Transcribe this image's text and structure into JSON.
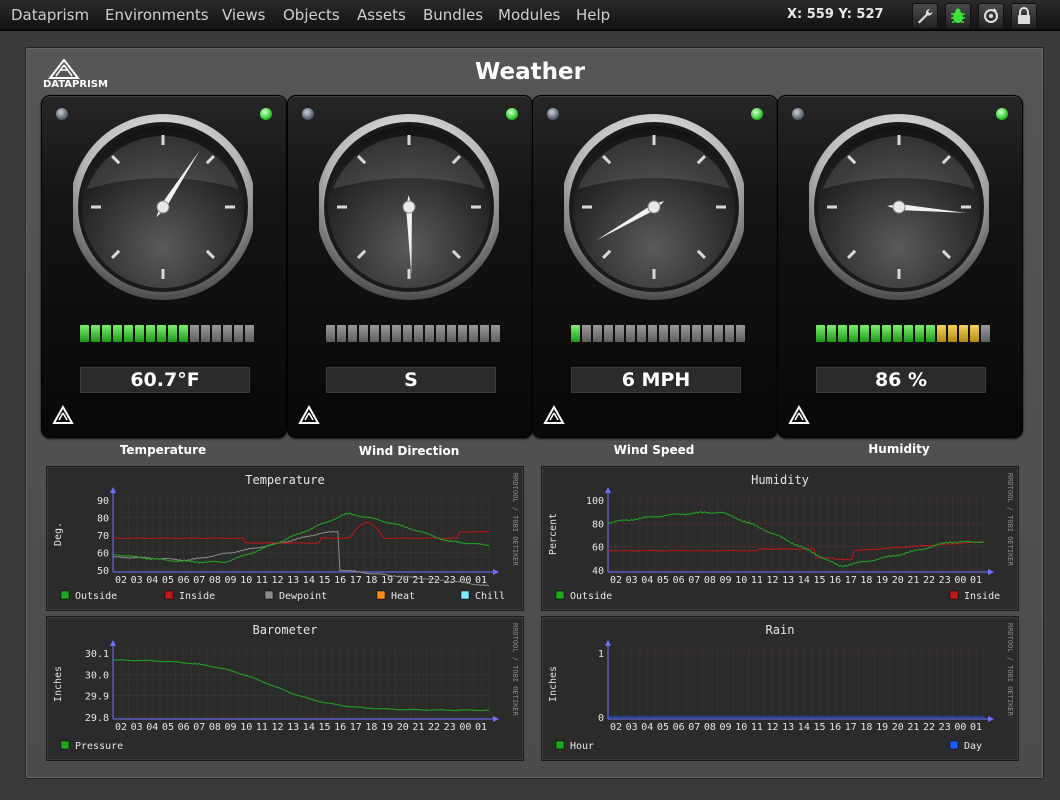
{
  "menu": [
    "Dataprism",
    "Environments",
    "Views",
    "Objects",
    "Assets",
    "Bundles",
    "Modules",
    "Help"
  ],
  "coords": "X: 559 Y: 527",
  "toolbar_icons": [
    "wrench-icon",
    "bug-icon",
    "refresh-icon",
    "lock-icon"
  ],
  "logo_text": "DATAPRISM",
  "title": "Weather",
  "gauges": [
    {
      "label": "Temperature",
      "value": "60.7°F",
      "leds": "ggggggggggoooooo"
    },
    {
      "label": "Wind Direction",
      "value": "S",
      "leds": "oooooooooooooooo"
    },
    {
      "label": "Wind Speed",
      "value": "6 MPH",
      "leds": "gooooooooooooooo"
    },
    {
      "label": "Humidity",
      "value": "86 %",
      "leds": "gggggggggggyyyyo"
    }
  ],
  "side_text": "RRDTOOL / TOBI OETIKER",
  "graphs": {
    "temperature": {
      "title": "Temperature",
      "ylabel": "Deg.",
      "yticks": [
        "90",
        "80",
        "70",
        "60",
        "50"
      ],
      "xticks": [
        "02",
        "03",
        "04",
        "05",
        "06",
        "07",
        "08",
        "09",
        "10",
        "11",
        "12",
        "13",
        "14",
        "15",
        "16",
        "17",
        "18",
        "19",
        "20",
        "21",
        "22",
        "23",
        "00",
        "01"
      ],
      "legend": [
        {
          "name": "Outside",
          "color": "#1fa81f"
        },
        {
          "name": "Inside",
          "color": "#c01818"
        },
        {
          "name": "Dewpoint",
          "color": "#8a8a8a"
        },
        {
          "name": "Heat",
          "color": "#ff8a1a"
        },
        {
          "name": "Chill",
          "color": "#7fe8ff"
        }
      ]
    },
    "humidity": {
      "title": "Humidity",
      "ylabel": "Percent",
      "yticks": [
        "100",
        "80",
        "60",
        "40"
      ],
      "xticks": [
        "02",
        "03",
        "04",
        "05",
        "06",
        "07",
        "08",
        "09",
        "10",
        "11",
        "12",
        "13",
        "14",
        "15",
        "16",
        "17",
        "18",
        "19",
        "20",
        "21",
        "22",
        "23",
        "00",
        "01"
      ],
      "legend": [
        {
          "name": "Outside",
          "color": "#1fa81f"
        },
        {
          "name": "Inside",
          "color": "#c01818"
        }
      ]
    },
    "barometer": {
      "title": "Barometer",
      "ylabel": "Inches",
      "yticks": [
        "30.1",
        "30.0",
        "29.9",
        "29.8"
      ],
      "xticks": [
        "02",
        "03",
        "04",
        "05",
        "06",
        "07",
        "08",
        "09",
        "10",
        "11",
        "12",
        "13",
        "14",
        "15",
        "16",
        "17",
        "18",
        "19",
        "20",
        "21",
        "22",
        "23",
        "00",
        "01"
      ],
      "legend": [
        {
          "name": "Pressure",
          "color": "#1fa81f"
        }
      ]
    },
    "rain": {
      "title": "Rain",
      "ylabel": "Inches",
      "yticks": [
        "1",
        "0"
      ],
      "xticks": [
        "02",
        "03",
        "04",
        "05",
        "06",
        "07",
        "08",
        "09",
        "10",
        "11",
        "12",
        "13",
        "14",
        "15",
        "16",
        "17",
        "18",
        "19",
        "20",
        "21",
        "22",
        "23",
        "00",
        "01"
      ],
      "legend": [
        {
          "name": "Hour",
          "color": "#1fa81f"
        },
        {
          "name": "Day",
          "color": "#1a5cff"
        }
      ]
    }
  },
  "colors": {
    "outside": "#1fa81f",
    "inside": "#c01818",
    "dewpoint": "#8a8a8a",
    "heat": "#ff8a1a",
    "day": "#1a5cff",
    "axis": "#7070ff"
  }
}
